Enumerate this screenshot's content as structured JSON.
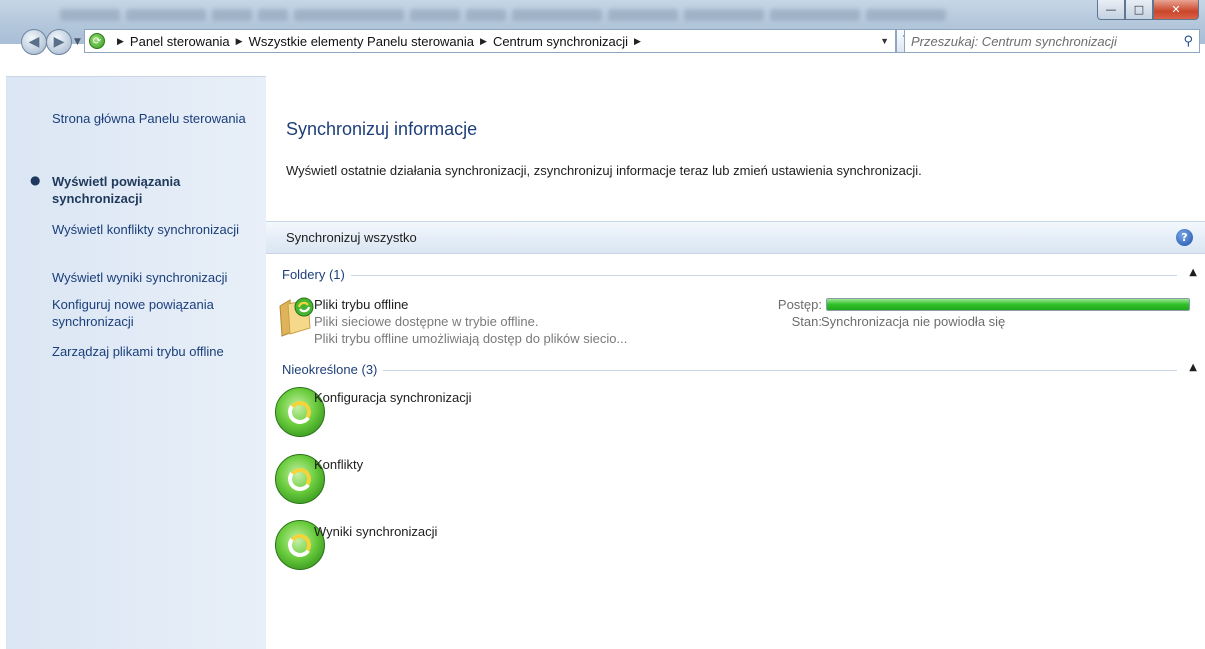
{
  "address": {
    "crumbs": [
      "Panel sterowania",
      "Wszystkie elementy Panelu sterowania",
      "Centrum synchronizacji"
    ],
    "search_placeholder": "Przeszukaj: Centrum synchronizacji"
  },
  "sidebar": {
    "items": [
      {
        "label": "Strona główna Panelu sterowania"
      },
      {
        "label": "Wyświetl powiązania synchronizacji"
      },
      {
        "label": "Wyświetl konflikty synchronizacji"
      },
      {
        "label": "Wyświetl wyniki synchronizacji"
      },
      {
        "label": "Konfiguruj nowe powiązania synchronizacji"
      },
      {
        "label": "Zarządzaj plikami trybu offline"
      }
    ],
    "active_index": 1
  },
  "main": {
    "title": "Synchronizuj informacje",
    "description": "Wyświetl ostatnie działania synchronizacji, zsynchronizuj informacje teraz lub zmień ustawienia synchronizacji.",
    "toolbar": {
      "sync_all": "Synchronizuj wszystko"
    },
    "groups": [
      {
        "label": "Foldery (1)",
        "items": [
          {
            "title": "Pliki trybu offline",
            "line1": "Pliki sieciowe dostępne w trybie offline.",
            "line2": "Pliki trybu offline umożliwiają dostęp do plików siecio...",
            "progress_label": "Postęp:",
            "progress_value": 1.0,
            "status_label": "Stan:",
            "status_value": "Synchronizacja nie powiodła się"
          }
        ]
      },
      {
        "label": "Nieokreślone (3)",
        "items": [
          {
            "title": "Konfiguracja synchronizacji"
          },
          {
            "title": "Konflikty"
          },
          {
            "title": "Wyniki synchronizacji"
          }
        ]
      }
    ]
  },
  "colors": {
    "link": "#1a3f7a",
    "title": "#1e3f7a",
    "progress": "#30c12a"
  }
}
